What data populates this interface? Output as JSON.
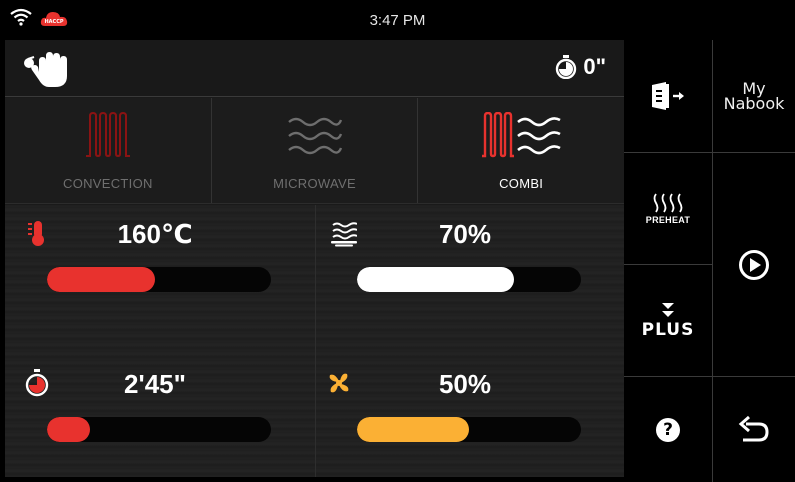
{
  "status": {
    "time": "3:47 PM",
    "haccp_label": "HACCP"
  },
  "topbar": {
    "timer_value": "0\""
  },
  "modes": [
    {
      "label": "CONVECTION",
      "active": false
    },
    {
      "label": "MICROWAVE",
      "active": false
    },
    {
      "label": "COMBI",
      "active": true
    }
  ],
  "params": {
    "temperature": {
      "value": "160℃",
      "fill_percent": 48,
      "color": "#e8322e"
    },
    "microwave_power": {
      "value": "70%",
      "fill_percent": 70,
      "color": "#ffffff"
    },
    "time": {
      "value": "2'45\"",
      "fill_percent": 19,
      "color": "#e8322e"
    },
    "fan_speed": {
      "value": "50%",
      "fill_percent": 50,
      "color": "#fbb034"
    }
  },
  "sidebar": {
    "mynabook_line1": "My",
    "mynabook_line2": "Nabook",
    "preheat_label": "PREHEAT",
    "plus_label": "PLUS",
    "help_label": "?"
  },
  "colors": {
    "accent_red": "#e8322e",
    "accent_orange": "#fbb034",
    "background": "#1a1a1a"
  }
}
